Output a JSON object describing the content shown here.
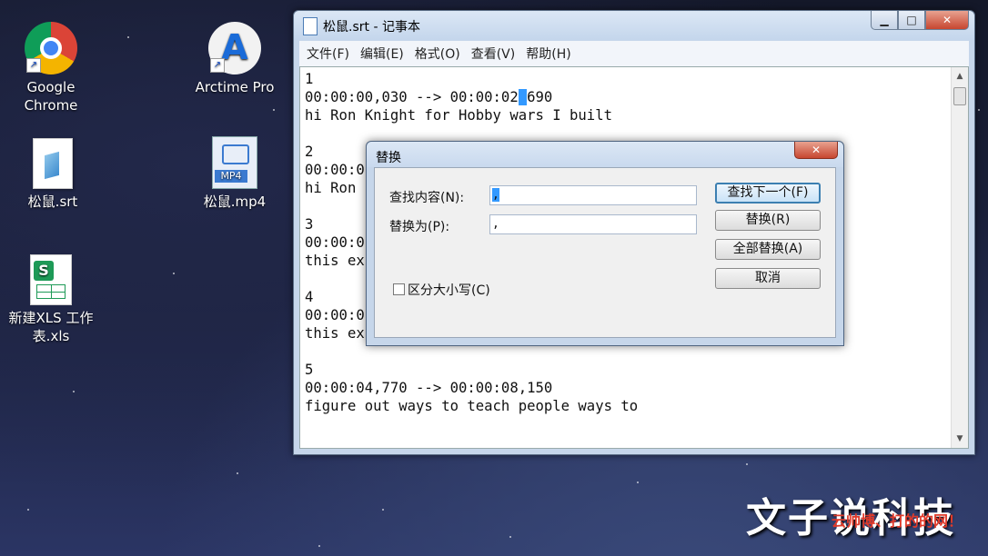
{
  "desktop": {
    "icons": [
      {
        "label": "Google Chrome",
        "icon": "chrome-icon"
      },
      {
        "label": "Arctime Pro",
        "icon": "arctime-icon"
      },
      {
        "label": "松鼠.srt",
        "icon": "text-file-icon"
      },
      {
        "label": "松鼠.mp4",
        "icon": "video-file-icon"
      },
      {
        "label": "新建XLS 工作表.xls",
        "icon": "spreadsheet-icon"
      }
    ]
  },
  "notepad": {
    "title": "松鼠.srt - 记事本",
    "window_buttons": {
      "minimize": "▁",
      "maximize": "□",
      "close": "✕"
    },
    "menu": [
      "文件(F)",
      "编辑(E)",
      "格式(O)",
      "查看(V)",
      "帮助(H)"
    ],
    "lines": [
      "1",
      "00:00:00,030 --> 00:00:02",
      "hi Ron Knight for Hobby wars I built",
      "",
      "2",
      "00:00:0",
      "hi Ron",
      "",
      "3",
      "00:00:0",
      "this ex",
      "",
      "4",
      "00:00:0",
      "this ex",
      "",
      "5",
      "00:00:04,770 --> 00:00:08,150",
      "figure out ways to teach people ways to"
    ],
    "selected_char": ",",
    "line2_rest": "690"
  },
  "replace_dialog": {
    "title": "替换",
    "close": "✕",
    "find_label": "查找内容(N):",
    "find_value": ",",
    "replace_label": "替换为(P):",
    "replace_value": ",",
    "match_case_label": "区分大小写(C)",
    "match_case_checked": false,
    "buttons": {
      "find_next": "查找下一个(F)",
      "replace": "替换(R)",
      "replace_all": "全部替换(A)",
      "cancel": "取消"
    }
  },
  "watermark": {
    "main": "文子说科技",
    "sub": "云帅博、打的的网！"
  }
}
